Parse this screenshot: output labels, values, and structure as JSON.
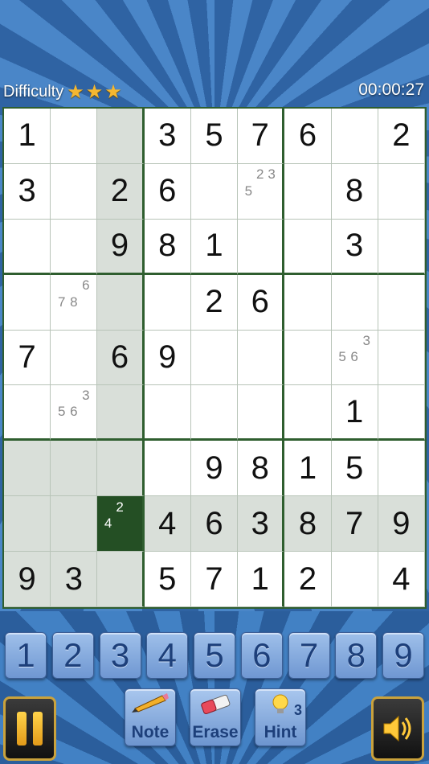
{
  "header": {
    "difficulty_label": "Difficulty",
    "stars": 3,
    "timer": "00:00:27"
  },
  "board": {
    "rows": [
      [
        "1",
        "",
        "",
        "3",
        "5",
        "7",
        "6",
        "",
        "2"
      ],
      [
        "3",
        "",
        "2",
        "6",
        "",
        "",
        "",
        "8",
        ""
      ],
      [
        "",
        "",
        "9",
        "8",
        "1",
        "",
        "",
        "3",
        ""
      ],
      [
        "",
        "",
        "",
        "",
        "2",
        "6",
        "",
        "",
        ""
      ],
      [
        "7",
        "",
        "6",
        "9",
        "",
        "",
        "",
        "",
        ""
      ],
      [
        "",
        "",
        "",
        "",
        "",
        "",
        "",
        "1",
        ""
      ],
      [
        "",
        "",
        "",
        "",
        "9",
        "8",
        "1",
        "5",
        ""
      ],
      [
        "",
        "",
        "",
        "4",
        "6",
        "3",
        "8",
        "7",
        "9"
      ],
      [
        "9",
        "3",
        "",
        "5",
        "7",
        "1",
        "2",
        "",
        "4"
      ]
    ],
    "notes": {
      "1-5": [
        "",
        "2",
        "3",
        "5",
        "",
        "",
        "",
        "",
        ""
      ],
      "3-1": [
        "",
        "",
        "6",
        "7",
        "8",
        "",
        "",
        "",
        ""
      ],
      "4-7": [
        "",
        "",
        "3",
        "5",
        "6",
        "",
        "",
        "",
        ""
      ],
      "5-1": [
        "",
        "",
        "3",
        "5",
        "6",
        "",
        "",
        "",
        ""
      ],
      "7-2": [
        "",
        "2",
        "",
        "4",
        "",
        "",
        "",
        "",
        ""
      ]
    },
    "selected": "7-2"
  },
  "numpad": [
    "1",
    "2",
    "3",
    "4",
    "5",
    "6",
    "7",
    "8",
    "9"
  ],
  "tools": {
    "note_label": "Note",
    "erase_label": "Erase",
    "hint_label": "Hint",
    "hint_count": "3"
  },
  "colors": {
    "grid_border": "#2f5e2f",
    "selected_cell": "#244f24",
    "highlight_cell": "#d9dfd9"
  }
}
